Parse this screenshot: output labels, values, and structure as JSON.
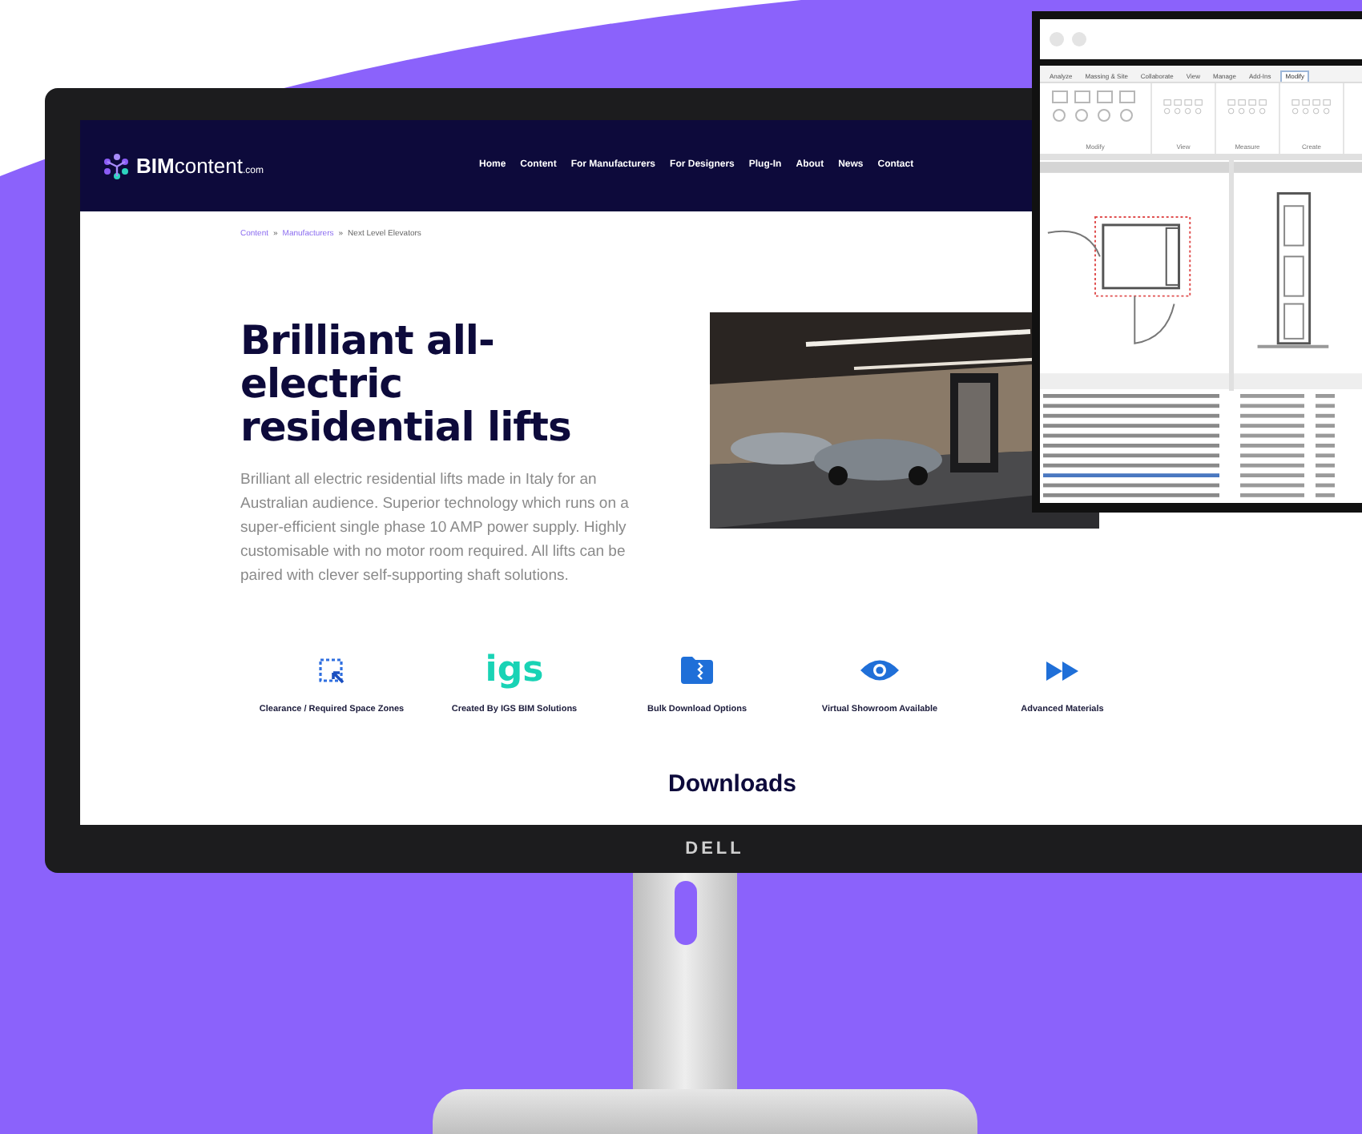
{
  "website": {
    "logo": {
      "brand": "BIM",
      "name": "content",
      "tld": ".com"
    },
    "nav": [
      "Home",
      "Content",
      "For Manufacturers",
      "For Designers",
      "Plug-In",
      "About",
      "News",
      "Contact"
    ],
    "breadcrumb": {
      "separator": "»",
      "items": [
        {
          "label": "Content",
          "kind": "link"
        },
        {
          "label": "Manufacturers",
          "kind": "link"
        },
        {
          "label": "Next Level Elevators",
          "kind": "current"
        }
      ]
    },
    "heading": "Brilliant all-electric residential lifts",
    "description": "Brilliant all electric residential lifts made in Italy for an Australian audience. Superior technology which runs on a super-efficient single phase 10 AMP power supply. Highly customisable with no motor room required. All lifts can be paired with clever self-supporting shaft solutions.",
    "features": [
      {
        "kind": "clearance",
        "label": "Clearance / Required Space Zones"
      },
      {
        "kind": "logo",
        "logo_text": "igs",
        "label": "Created By IGS BIM Solutions"
      },
      {
        "kind": "folder",
        "label": "Bulk Download Options"
      },
      {
        "kind": "eye",
        "label": "Virtual Showroom Available"
      },
      {
        "kind": "forward",
        "label": "Advanced Materials"
      }
    ],
    "section_heading": "Downloads"
  },
  "monitor": {
    "brand": "DELL"
  },
  "cad_window": {
    "ribbon_tabs": [
      {
        "label": "Analyze",
        "selected": false
      },
      {
        "label": "Massing & Site",
        "selected": false
      },
      {
        "label": "Collaborate",
        "selected": false
      },
      {
        "label": "View",
        "selected": false
      },
      {
        "label": "Manage",
        "selected": false
      },
      {
        "label": "Add-Ins",
        "selected": false
      },
      {
        "label": "Modify",
        "selected": true
      }
    ],
    "ribbon_panels": [
      "Modify",
      "View",
      "Measure",
      "Create"
    ]
  }
}
